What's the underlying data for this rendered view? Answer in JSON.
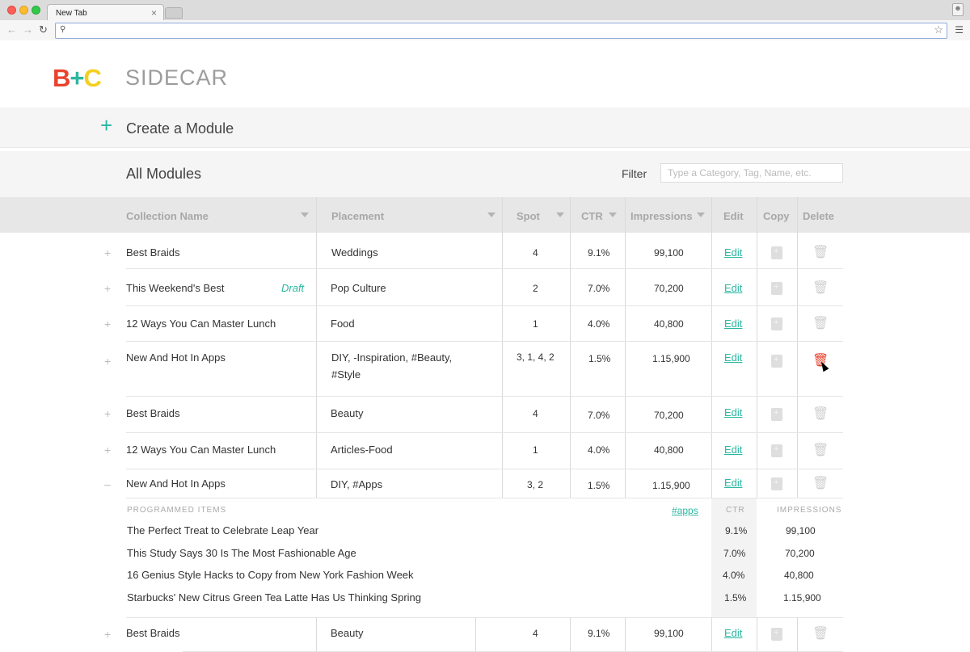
{
  "browser": {
    "tab_title": "New Tab",
    "tab_close": "×",
    "address_value": ""
  },
  "app": {
    "logo": {
      "b": "B",
      "plus": "+",
      "c": "C"
    },
    "brand": "SIDECAR",
    "create": {
      "icon": "+",
      "label": "Create a Module"
    },
    "list": {
      "title": "All Modules",
      "filter_label": "Filter",
      "filter_placeholder": "Type a Category, Tag, Name, etc."
    },
    "columns": {
      "collection": "Collection Name",
      "placement": "Placement",
      "spot": "Spot",
      "ctr": "CTR",
      "impressions": "Impressions",
      "edit": "Edit",
      "copy": "Copy",
      "delete": "Delete"
    },
    "rows": [
      {
        "expand": "+",
        "name": "Best Braids",
        "draft": "",
        "placement": "Weddings",
        "spot": "4",
        "ctr": "9.1%",
        "impressions": "99,100",
        "edit": "Edit"
      },
      {
        "expand": "+",
        "name": "This Weekend's Best",
        "draft": "Draft",
        "placement": "Pop Culture",
        "spot": "2",
        "ctr": "7.0%",
        "impressions": "70,200",
        "edit": "Edit"
      },
      {
        "expand": "+",
        "name": "12 Ways You Can Master Lunch",
        "draft": "",
        "placement": "Food",
        "spot": "1",
        "ctr": "4.0%",
        "impressions": "40,800",
        "edit": "Edit"
      },
      {
        "expand": "+",
        "name": "New And Hot In Apps",
        "draft": "",
        "placement_line1": "DIY, -Inspiration, #Beauty,",
        "placement_line2": "#Style",
        "spot": "3, 1, 4, 2",
        "ctr": "1.5%",
        "impressions": "1.15,900",
        "edit": "Edit"
      },
      {
        "expand": "+",
        "name": "Best Braids",
        "draft": "",
        "placement": "Beauty",
        "spot": "4",
        "ctr": "7.0%",
        "impressions": "70,200",
        "edit": "Edit"
      },
      {
        "expand": "+",
        "name": "12 Ways You Can Master Lunch",
        "draft": "",
        "placement": "Articles-Food",
        "spot": "1",
        "ctr": "4.0%",
        "impressions": "40,800",
        "edit": "Edit"
      },
      {
        "expand": "–",
        "name": "New And Hot In Apps",
        "draft": "",
        "placement": "DIY, #Apps",
        "spot": "3, 2",
        "ctr": "1.5%",
        "impressions": "1.15,900",
        "edit": "Edit"
      },
      {
        "expand": "+",
        "name": "Best Braids",
        "draft": "",
        "placement": "Beauty",
        "spot": "4",
        "ctr": "9.1%",
        "impressions": "99,100",
        "edit": "Edit"
      }
    ],
    "programmed": {
      "header": "PROGRAMMED ITEMS",
      "tag": "#apps",
      "ctr_header": "CTR",
      "impressions_header": "IMPRESSIONS",
      "items": [
        {
          "title": "The Perfect Treat to Celebrate Leap Year",
          "ctr": "9.1%",
          "impressions": "99,100"
        },
        {
          "title": "This Study Says 30 Is The Most Fashionable Age",
          "ctr": "7.0%",
          "impressions": "70,200"
        },
        {
          "title": "16 Genius Style Hacks to Copy from New York Fashion Week",
          "ctr": "4.0%",
          "impressions": "40,800"
        },
        {
          "title": "Starbucks' New Citrus Green Tea Latte Has Us Thinking Spring",
          "ctr": "1.5%",
          "impressions": "1.15,900"
        }
      ]
    },
    "colors": {
      "accent": "#2bb7a1",
      "logo_b": "#e8432e",
      "logo_c": "#f5cf1e",
      "delete_hover": "#e8432e"
    }
  }
}
